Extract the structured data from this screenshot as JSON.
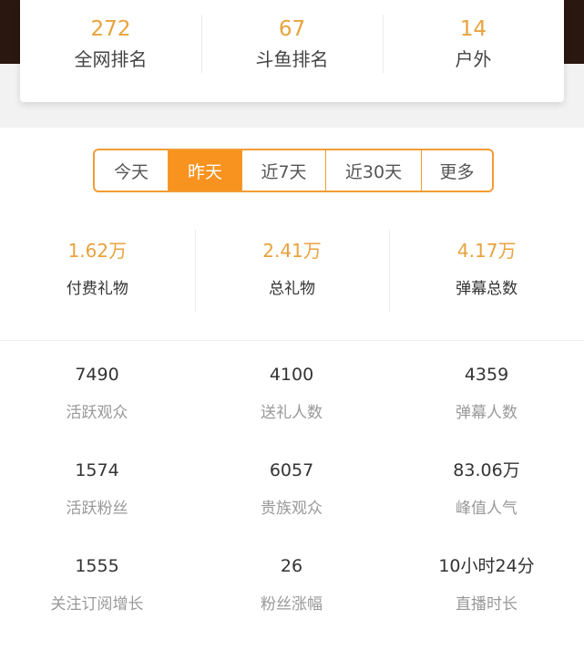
{
  "ranks": [
    {
      "value": "272",
      "label": "全网排名"
    },
    {
      "value": "67",
      "label": "斗鱼排名"
    },
    {
      "value": "14",
      "label": "户外"
    }
  ],
  "tabs": [
    {
      "label": "今天",
      "active": false
    },
    {
      "label": "昨天",
      "active": true
    },
    {
      "label": "近7天",
      "active": false
    },
    {
      "label": "近30天",
      "active": false
    },
    {
      "label": "更多",
      "active": false
    }
  ],
  "summary": [
    {
      "value": "1.62万",
      "label": "付费礼物"
    },
    {
      "value": "2.41万",
      "label": "总礼物"
    },
    {
      "value": "4.17万",
      "label": "弹幕总数"
    }
  ],
  "stats": [
    {
      "value": "7490",
      "label": "活跃观众"
    },
    {
      "value": "4100",
      "label": "送礼人数"
    },
    {
      "value": "4359",
      "label": "弹幕人数"
    },
    {
      "value": "1574",
      "label": "活跃粉丝"
    },
    {
      "value": "6057",
      "label": "贵族观众"
    },
    {
      "value": "83.06万",
      "label": "峰值人气"
    },
    {
      "value": "1555",
      "label": "关注订阅增长"
    },
    {
      "value": "26",
      "label": "粉丝涨幅"
    },
    {
      "value": "10小时24分",
      "label": "直播时长"
    }
  ],
  "colors": {
    "accent": "#f7931e",
    "rank_value": "#e8a23d",
    "top_band": "#2a1810"
  }
}
